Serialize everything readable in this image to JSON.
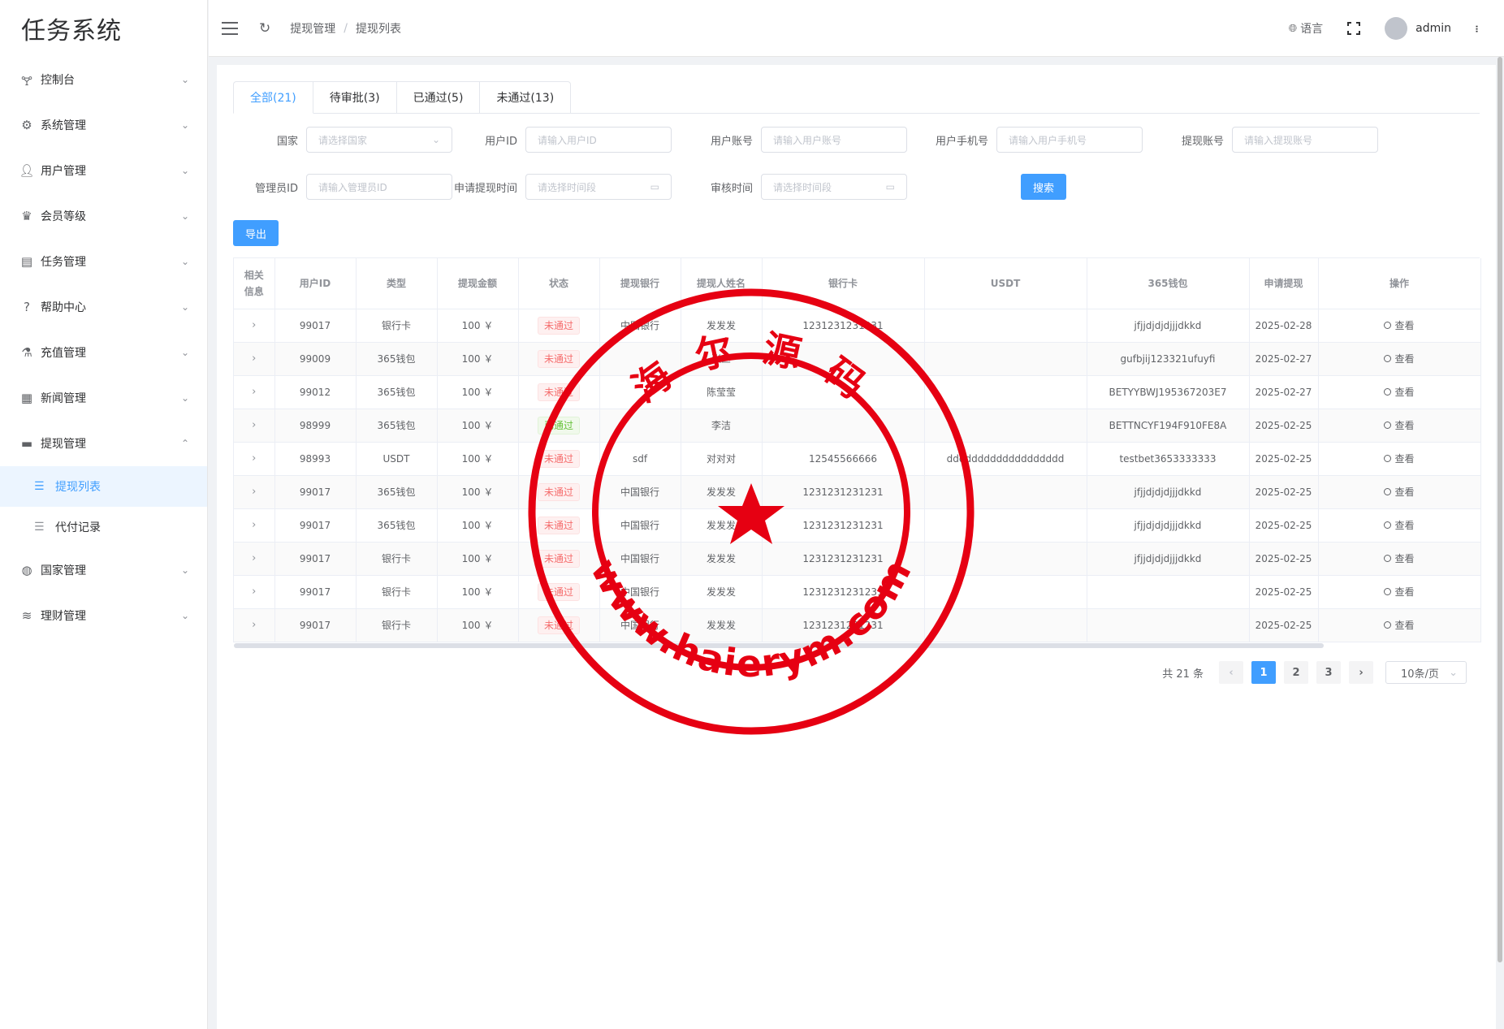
{
  "app": {
    "title": "任务系统"
  },
  "sidebar": {
    "items": [
      {
        "label": "控制台",
        "icon": "dashboard-icon",
        "arrow": "⌄"
      },
      {
        "label": "系统管理",
        "icon": "gear-icon",
        "arrow": "⌄"
      },
      {
        "label": "用户管理",
        "icon": "user-icon",
        "arrow": "⌄"
      },
      {
        "label": "会员等级",
        "icon": "crown-icon",
        "arrow": "⌄"
      },
      {
        "label": "任务管理",
        "icon": "clipboard-icon",
        "arrow": "⌄"
      },
      {
        "label": "帮助中心",
        "icon": "help-icon",
        "arrow": "⌄"
      },
      {
        "label": "充值管理",
        "icon": "flask-icon",
        "arrow": "⌄"
      },
      {
        "label": "新闻管理",
        "icon": "news-icon",
        "arrow": "⌄"
      },
      {
        "label": "提现管理",
        "icon": "wallet-icon",
        "arrow": "⌃"
      }
    ],
    "submenu": [
      {
        "label": "提现列表",
        "active": true
      },
      {
        "label": "代付记录",
        "active": false
      }
    ],
    "bottom_items": [
      {
        "label": "国家管理",
        "icon": "globe-icon",
        "arrow": "⌄"
      },
      {
        "label": "理财管理",
        "icon": "database-icon",
        "arrow": "⌄"
      }
    ]
  },
  "header": {
    "breadcrumb": [
      "提现管理",
      "提现列表"
    ],
    "breadcrumb_sep": "/",
    "language": "语言",
    "username": "admin"
  },
  "tabs": [
    {
      "label": "全部(21)",
      "active": true
    },
    {
      "label": "待审批(3)",
      "active": false
    },
    {
      "label": "已通过(5)",
      "active": false
    },
    {
      "label": "未通过(13)",
      "active": false
    }
  ],
  "filters": {
    "country": {
      "label": "国家",
      "placeholder": "请选择国家"
    },
    "user_id": {
      "label": "用户ID",
      "placeholder": "请输入用户ID"
    },
    "user_account": {
      "label": "用户账号",
      "placeholder": "请输入用户账号"
    },
    "user_phone": {
      "label": "用户手机号",
      "placeholder": "请输入用户手机号"
    },
    "withdraw_account": {
      "label": "提现账号",
      "placeholder": "请输入提现账号"
    },
    "admin_id": {
      "label": "管理员ID",
      "placeholder": "请输入管理员ID"
    },
    "apply_time": {
      "label": "申请提现时间",
      "placeholder": "请选择时间段"
    },
    "review_time": {
      "label": "审核时间",
      "placeholder": "请选择时间段"
    },
    "search_button": "搜索",
    "export_button": "导出"
  },
  "table": {
    "columns": [
      "相关信息",
      "用户ID",
      "类型",
      "提现金额",
      "状态",
      "提现银行",
      "提现人姓名",
      "银行卡",
      "USDT",
      "365钱包",
      "申请提现",
      "操作"
    ],
    "action_label": "查看",
    "rows": [
      {
        "user_id": "99017",
        "type": "银行卡",
        "amount": "100 ￥",
        "status": "未通过",
        "status_kind": "danger",
        "bank": "中国银行",
        "name": "发发发",
        "card": "1231231231231",
        "usdt": "",
        "wallet": "jfjjdjdjdjjjdkkd",
        "date": "2025-02-28"
      },
      {
        "user_id": "99009",
        "type": "365钱包",
        "amount": "100 ￥",
        "status": "未通过",
        "status_kind": "danger",
        "bank": "",
        "name": "张三",
        "card": "",
        "usdt": "",
        "wallet": "gufbjij123321ufuyfi",
        "date": "2025-02-27"
      },
      {
        "user_id": "99012",
        "type": "365钱包",
        "amount": "100 ￥",
        "status": "未通过",
        "status_kind": "danger",
        "bank": "",
        "name": "陈莹莹",
        "card": "",
        "usdt": "",
        "wallet": "BETYYBWJ195367203E7",
        "date": "2025-02-27"
      },
      {
        "user_id": "98999",
        "type": "365钱包",
        "amount": "100 ￥",
        "status": "已通过",
        "status_kind": "success",
        "bank": "",
        "name": "李洁",
        "card": "",
        "usdt": "",
        "wallet": "BETTNCYF194F910FE8A",
        "date": "2025-02-25"
      },
      {
        "user_id": "98993",
        "type": "USDT",
        "amount": "100 ￥",
        "status": "未通过",
        "status_kind": "danger",
        "bank": "sdf",
        "name": "对对对",
        "card": "12545566666",
        "usdt": "ddddddddddddddddddd",
        "wallet": "testbet3653333333",
        "date": "2025-02-25"
      },
      {
        "user_id": "99017",
        "type": "365钱包",
        "amount": "100 ￥",
        "status": "未通过",
        "status_kind": "danger",
        "bank": "中国银行",
        "name": "发发发",
        "card": "1231231231231",
        "usdt": "",
        "wallet": "jfjjdjdjdjjjdkkd",
        "date": "2025-02-25"
      },
      {
        "user_id": "99017",
        "type": "365钱包",
        "amount": "100 ￥",
        "status": "未通过",
        "status_kind": "danger",
        "bank": "中国银行",
        "name": "发发发",
        "card": "1231231231231",
        "usdt": "",
        "wallet": "jfjjdjdjdjjjdkkd",
        "date": "2025-02-25"
      },
      {
        "user_id": "99017",
        "type": "银行卡",
        "amount": "100 ￥",
        "status": "未通过",
        "status_kind": "danger",
        "bank": "中国银行",
        "name": "发发发",
        "card": "1231231231231",
        "usdt": "",
        "wallet": "jfjjdjdjdjjjdkkd",
        "date": "2025-02-25"
      },
      {
        "user_id": "99017",
        "type": "银行卡",
        "amount": "100 ￥",
        "status": "未通过",
        "status_kind": "danger",
        "bank": "中国银行",
        "name": "发发发",
        "card": "1231231231231",
        "usdt": "",
        "wallet": "",
        "date": "2025-02-25"
      },
      {
        "user_id": "99017",
        "type": "银行卡",
        "amount": "100 ￥",
        "status": "未通过",
        "status_kind": "danger",
        "bank": "中国银行",
        "name": "发发发",
        "card": "1231231231231",
        "usdt": "",
        "wallet": "",
        "date": "2025-02-25"
      }
    ]
  },
  "pagination": {
    "total": "共 21 条",
    "pages": [
      "1",
      "2",
      "3"
    ],
    "current": "1",
    "page_size": "10条/页"
  },
  "watermark": {
    "top_text": "海 尔 源 码",
    "bottom_text": "www.haierym.com",
    "color": "#e60012"
  },
  "colors": {
    "primary": "#409eff",
    "danger": "#f56c6c",
    "success": "#67c23a"
  }
}
